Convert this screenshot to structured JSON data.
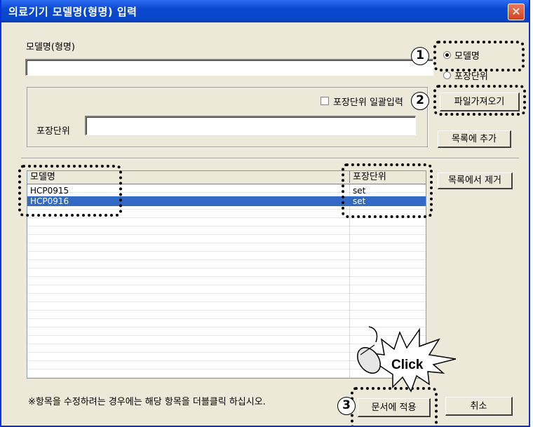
{
  "window": {
    "title": "의료기기 모델명(형명) 입력",
    "close_label": "✕"
  },
  "model": {
    "label": "모델명(형명)",
    "value": ""
  },
  "options": {
    "model_radio_label": "모델명",
    "package_radio_label": "포장단위",
    "selected": "모델명"
  },
  "package_group": {
    "checkbox_label": "포장단위 일괄입력",
    "checked": false,
    "field_label": "포장단위",
    "field_value": ""
  },
  "buttons": {
    "import_file": "파일가져오기",
    "add_to_list": "목록에 추가",
    "remove_from_list": "목록에서 제거",
    "apply_to_document": "문서에 적용",
    "cancel": "취소"
  },
  "list": {
    "columns": [
      "모델명",
      "포장단위"
    ],
    "rows": [
      {
        "model": "HCP0915",
        "unit": "set",
        "selected": false
      },
      {
        "model": "HCP0916",
        "unit": "set",
        "selected": true
      }
    ]
  },
  "hint": "※항목을 수정하려는 경우에는 해당 항목을 더블클릭 하십시오.",
  "annotations": {
    "step1": "1",
    "step2": "2",
    "step3": "3",
    "click_text": "Click"
  }
}
